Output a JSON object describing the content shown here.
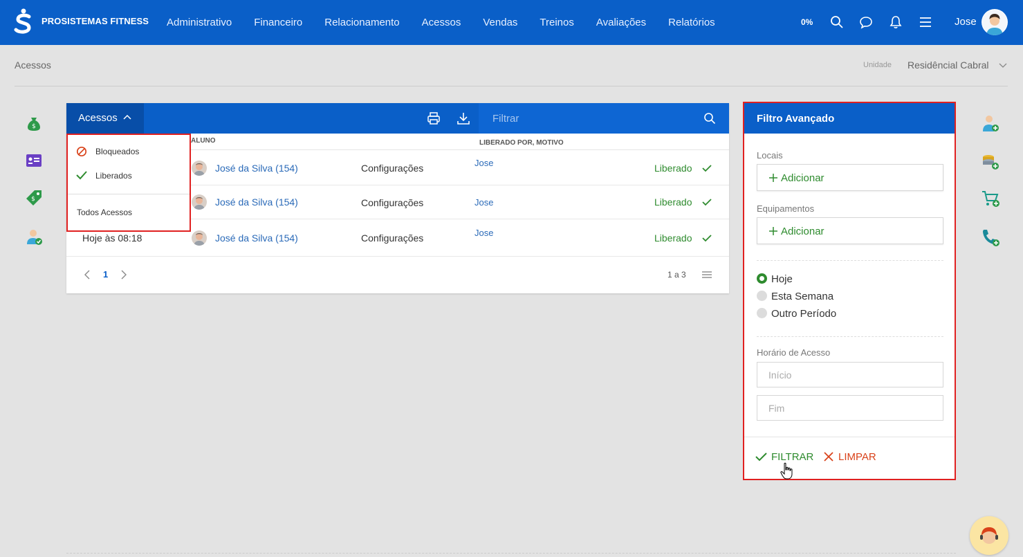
{
  "topbar": {
    "brand": "PROSISTEMAS FITNESS",
    "nav": [
      "Administrativo",
      "Financeiro",
      "Relacionamento",
      "Acessos",
      "Vendas",
      "Treinos",
      "Avaliações",
      "Relatórios"
    ],
    "progress": "0%",
    "user": "Jose",
    "icons": [
      "search-icon",
      "chat-icon",
      "bell-icon",
      "menu-icon"
    ]
  },
  "breadcrumb": "Acessos",
  "unit": {
    "label": "Unidade",
    "value": "Residêncial Cabral"
  },
  "table": {
    "tab_label": "Acessos",
    "filter_placeholder": "Filtrar",
    "headers": {
      "aluno": "ALUNO",
      "liberado": "LIBERADO POR, MOTIVO"
    },
    "rows": [
      {
        "date": "",
        "aluno": "José da Silva (154)",
        "origem": "Configurações",
        "por": "Jose",
        "status": "Liberado"
      },
      {
        "date": "",
        "aluno": "José da Silva (154)",
        "origem": "Configurações",
        "por": "Jose",
        "status": "Liberado"
      },
      {
        "date": "Hoje às 08:18",
        "aluno": "José da Silva (154)",
        "origem": "Configurações",
        "por": "Jose",
        "status": "Liberado"
      }
    ],
    "pager": {
      "page": "1",
      "count": "1 a 3"
    }
  },
  "dropdown": {
    "items": [
      "Bloqueados",
      "Liberados"
    ],
    "all": "Todos Acessos"
  },
  "advanced_filter": {
    "title": "Filtro Avançado",
    "locais_label": "Locais",
    "equipamentos_label": "Equipamentos",
    "add_label": "Adicionar",
    "periods": [
      "Hoje",
      "Esta Semana",
      "Outro Período"
    ],
    "selected_period": "Hoje",
    "horario_label": "Horário de Acesso",
    "inicio_placeholder": "Início",
    "fim_placeholder": "Fim",
    "filtrar": "FILTRAR",
    "limpar": "LIMPAR"
  },
  "colors": {
    "primary": "#0a5fc8",
    "success": "#2e8b2e",
    "danger": "#d9421a",
    "highlight": "#e02020"
  }
}
